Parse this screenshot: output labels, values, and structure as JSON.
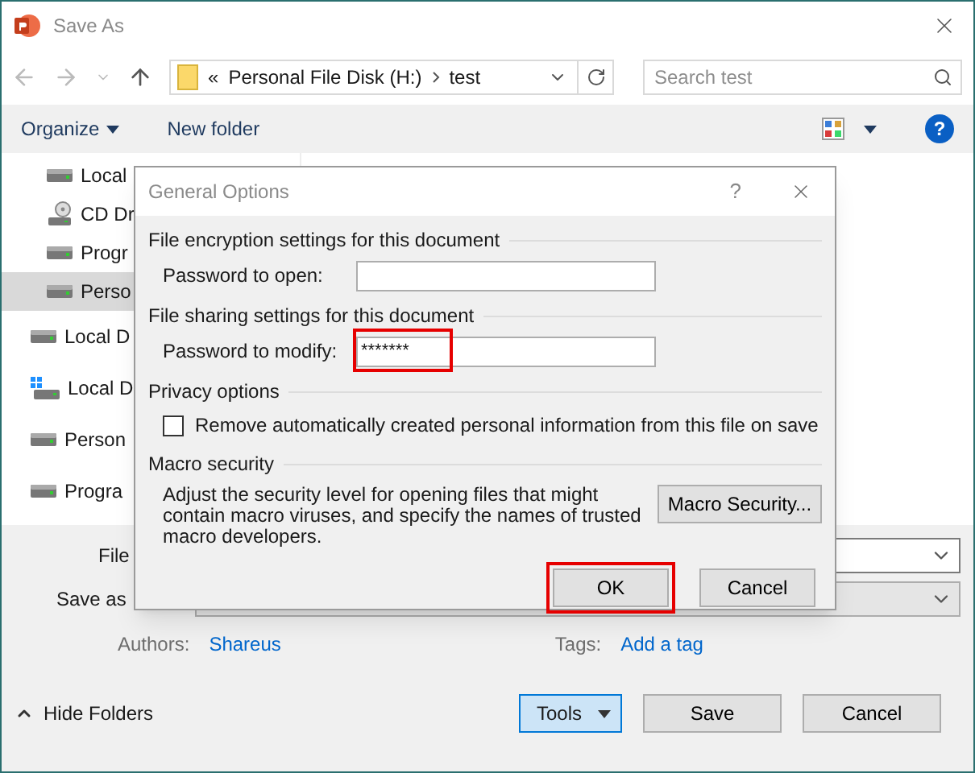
{
  "window": {
    "title": "Save As"
  },
  "nav": {
    "path_prefix": "«",
    "path": [
      "Personal File Disk (H:)",
      "test"
    ],
    "search": {
      "placeholder": "Search test"
    }
  },
  "toolbar": {
    "organize": "Organize",
    "new_folder": "New folder",
    "help": "?"
  },
  "sidebar": {
    "items": [
      {
        "label": "Local",
        "kind": "drive",
        "indent": true,
        "selected": false
      },
      {
        "label": "CD Dr",
        "kind": "cd",
        "indent": true,
        "selected": false
      },
      {
        "label": "Progr",
        "kind": "drive",
        "indent": true,
        "selected": false
      },
      {
        "label": "Perso",
        "kind": "drive",
        "indent": true,
        "selected": true
      },
      {
        "label": "Local D",
        "kind": "drive",
        "indent": false,
        "selected": false
      },
      {
        "label": "Local D",
        "kind": "windows",
        "indent": false,
        "selected": false
      },
      {
        "label": "Person",
        "kind": "drive",
        "indent": false,
        "selected": false
      },
      {
        "label": "Progra",
        "kind": "drive",
        "indent": false,
        "selected": false
      }
    ]
  },
  "form": {
    "file_name_label": "File",
    "save_type_label": "Save as",
    "authors_label": "Authors:",
    "authors_value": "Shareus",
    "tags_label": "Tags:",
    "tags_value": "Add a tag"
  },
  "footer": {
    "hide_folders": "Hide Folders",
    "buttons": [
      {
        "label": "Tools",
        "kind": "menu"
      },
      {
        "label": "Save",
        "kind": "plain"
      },
      {
        "label": "Cancel",
        "kind": "plain"
      }
    ]
  },
  "dialog": {
    "title": "General Options",
    "help": "?",
    "sections": [
      {
        "heading": "File encryption settings for this document",
        "kind": "field",
        "label": "Password to open:",
        "highlight": false
      },
      {
        "heading": "File sharing settings for this document",
        "kind": "field",
        "label": "Password to modify:",
        "value": "*******",
        "highlight": true
      },
      {
        "heading": "Privacy options",
        "kind": "checkbox",
        "label": "Remove automatically created personal information from this file on save",
        "checked": false
      },
      {
        "heading": "Macro security",
        "kind": "macro",
        "text": "Adjust the security level for opening files that might contain macro viruses, and specify the names of trusted macro developers.",
        "button": "Macro Security..."
      }
    ],
    "buttons": [
      {
        "label": "OK",
        "highlight": true
      },
      {
        "label": "Cancel",
        "highlight": false
      }
    ]
  }
}
